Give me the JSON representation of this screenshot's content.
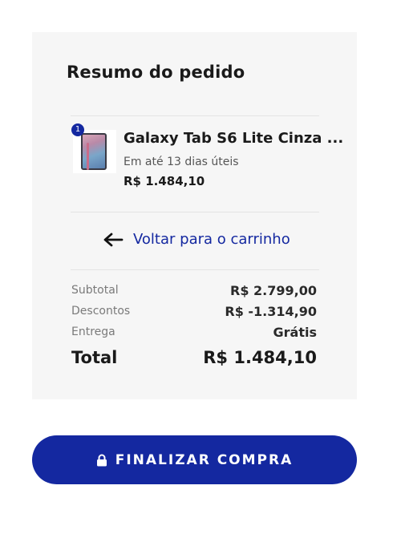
{
  "summary": {
    "title": "Resumo do pedido"
  },
  "product": {
    "quantity": "1",
    "name": "Galaxy Tab S6 Lite Cinza ...",
    "delivery": "Em até 13 dias úteis",
    "price": "R$ 1.484,10",
    "image_icon": "tablet-image"
  },
  "back_link": {
    "icon": "arrow-left-icon",
    "label": "Voltar para o carrinho"
  },
  "totals": {
    "subtotal_label": "Subtotal",
    "subtotal_value": "R$ 2.799,00",
    "discount_label": "Descontos",
    "discount_value": "R$ -1.314,90",
    "shipping_label": "Entrega",
    "shipping_value": "Grátis",
    "total_label": "Total",
    "total_value": "R$ 1.484,10"
  },
  "checkout": {
    "icon": "lock-icon",
    "label": "FINALIZAR COMPRA"
  },
  "colors": {
    "brand": "#1428a0",
    "card_background": "#f6f6f6"
  }
}
